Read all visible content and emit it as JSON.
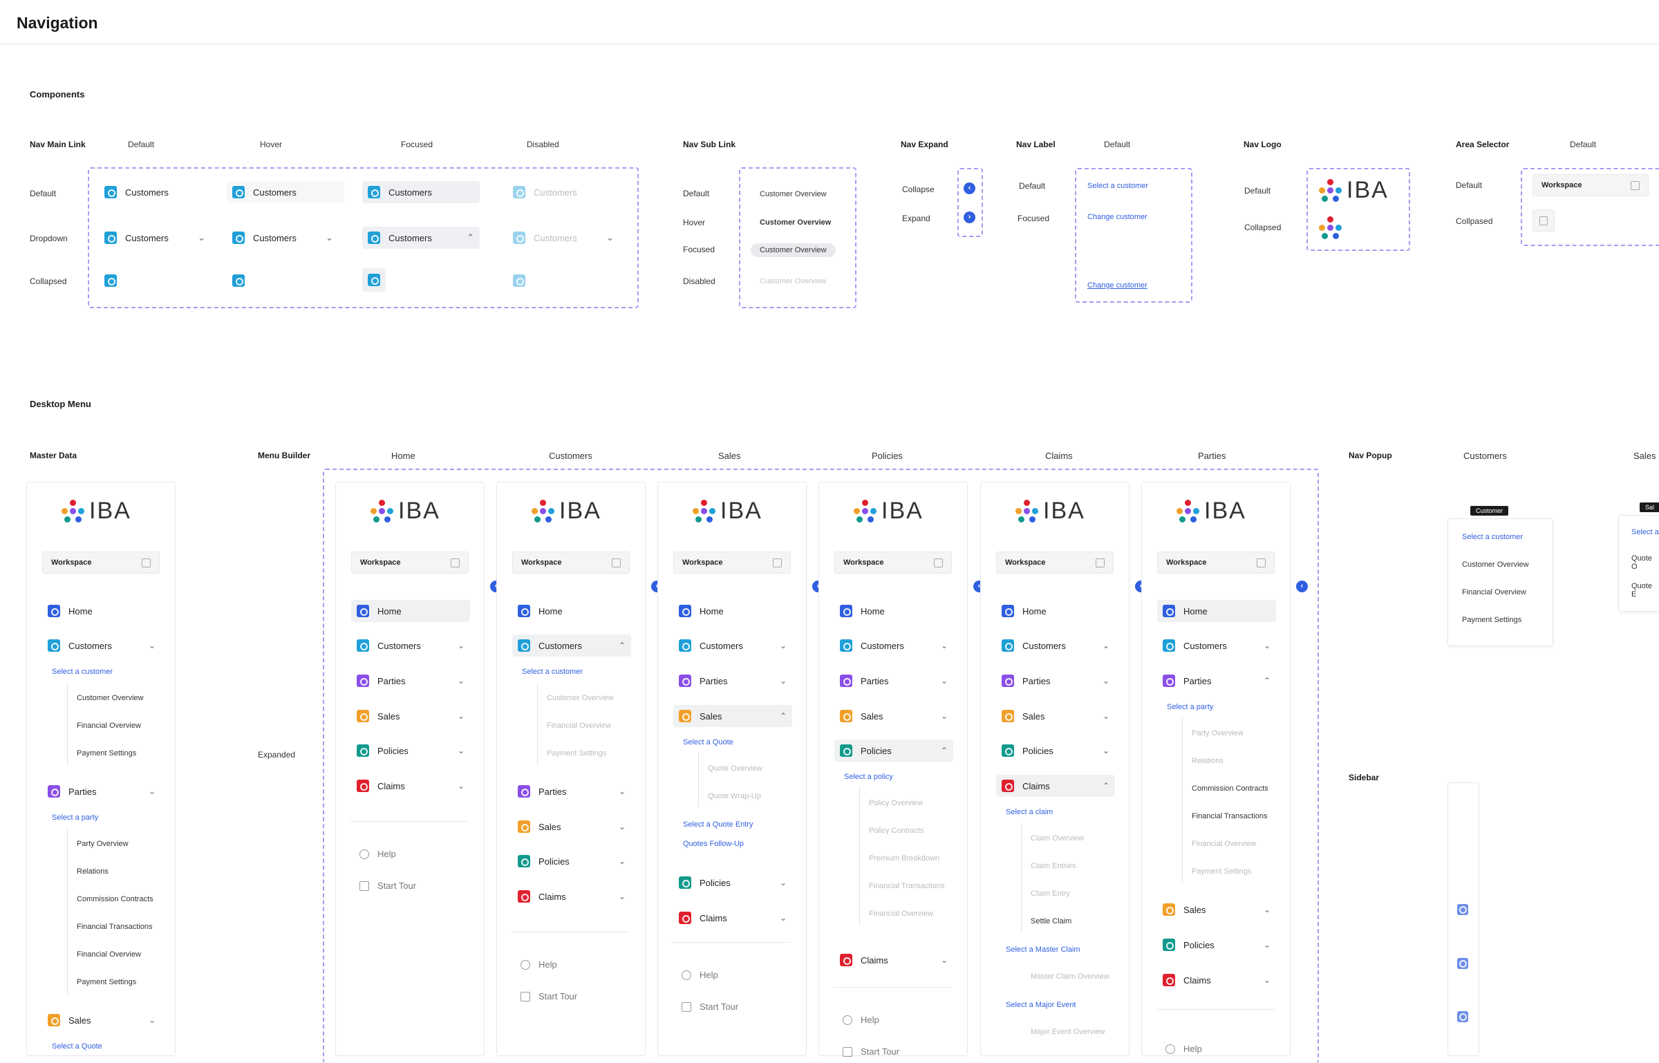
{
  "title": "Navigation",
  "components_heading": "Components",
  "desktop_heading": "Desktop Menu",
  "nav_main_link": {
    "title": "Nav Main Link",
    "states": [
      "Default",
      "Hover",
      "Focused",
      "Disabled"
    ],
    "rows": [
      "Default",
      "Dropdown",
      "Collapsed"
    ],
    "label": "Customers"
  },
  "nav_sub_link": {
    "title": "Nav Sub Link",
    "rows": [
      "Default",
      "Hover",
      "Focused",
      "Disabled"
    ],
    "label": "Customer Overview"
  },
  "nav_expand": {
    "title": "Nav Expand",
    "rows": [
      "Collapse",
      "Expand"
    ]
  },
  "nav_label": {
    "title": "Nav Label",
    "col": "Default",
    "rows": [
      "Default",
      "Focused"
    ],
    "select": "Select a customer",
    "change": "Change customer"
  },
  "nav_logo": {
    "title": "Nav Logo",
    "rows": [
      "Default",
      "Collapsed"
    ],
    "text": "IBA"
  },
  "area_selector": {
    "title": "Area Selector",
    "col": "Default",
    "rows": [
      "Default",
      "Collpased"
    ],
    "workspace": "Workspace"
  },
  "labels": {
    "master": "Master Data",
    "builder": "Menu Builder",
    "expanded": "Expanded",
    "popup": "Nav Popup",
    "sidebar": "Sidebar"
  },
  "columns": [
    "Home",
    "Customers",
    "Sales",
    "Policies",
    "Claims",
    "Parties"
  ],
  "popup_cols": [
    "Customers",
    "Sales"
  ],
  "menu": {
    "workspace": "Workspace",
    "home": "Home",
    "customers": "Customers",
    "parties": "Parties",
    "sales": "Sales",
    "policies": "Policies",
    "claims": "Claims",
    "help": "Help",
    "tour": "Start Tour"
  },
  "master_sub": {
    "select_customer": "Select a customer",
    "customer_items": [
      "Customer Overview",
      "Financial Overview",
      "Payment Settings"
    ],
    "select_party": "Select a party",
    "party_items": [
      "Party Overview",
      "Relations",
      "Commission Contracts",
      "Financial Transactions",
      "Financial Overview",
      "Payment Settings"
    ],
    "select_quote": "Select a Quote"
  },
  "sales_sub": {
    "select_quote": "Select a Quote",
    "items": [
      "Quote Overview",
      "Quote Wrap-Up"
    ],
    "entry": "Select a Quote Entry",
    "followup": "Quotes Follow-Up"
  },
  "policy_sub": {
    "select": "Select a policy",
    "items": [
      "Policy Overview",
      "Policy Contracts",
      "Premium Breakdown",
      "Financial Transactions",
      "Financial Overview"
    ]
  },
  "claim_sub": {
    "select": "Select a claim",
    "items": [
      "Claim Overview",
      "Claim Entries",
      "Claim Entry",
      "Settle Claim"
    ],
    "master": "Select a Master Claim",
    "master_item": "Master Claim Overview",
    "major": "Select a Major Event",
    "major_item": "Major Event Overview"
  },
  "popup": {
    "tag": "Customer",
    "select": "Select a customer",
    "items": [
      "Customer Overview",
      "Financial Overview",
      "Payment Settings"
    ],
    "tag2": "Sal",
    "select2": "Select a",
    "items2": [
      "Quote O",
      "Quote E"
    ]
  },
  "colors": {
    "home": "#2f5fe0",
    "customers": "#1fa0d8",
    "parties": "#8a4fe8",
    "sales": "#f0a02a",
    "policies": "#129a8d",
    "claims": "#e0202e",
    "link": "#2f5fe0",
    "dashed": "#a79cf3"
  }
}
